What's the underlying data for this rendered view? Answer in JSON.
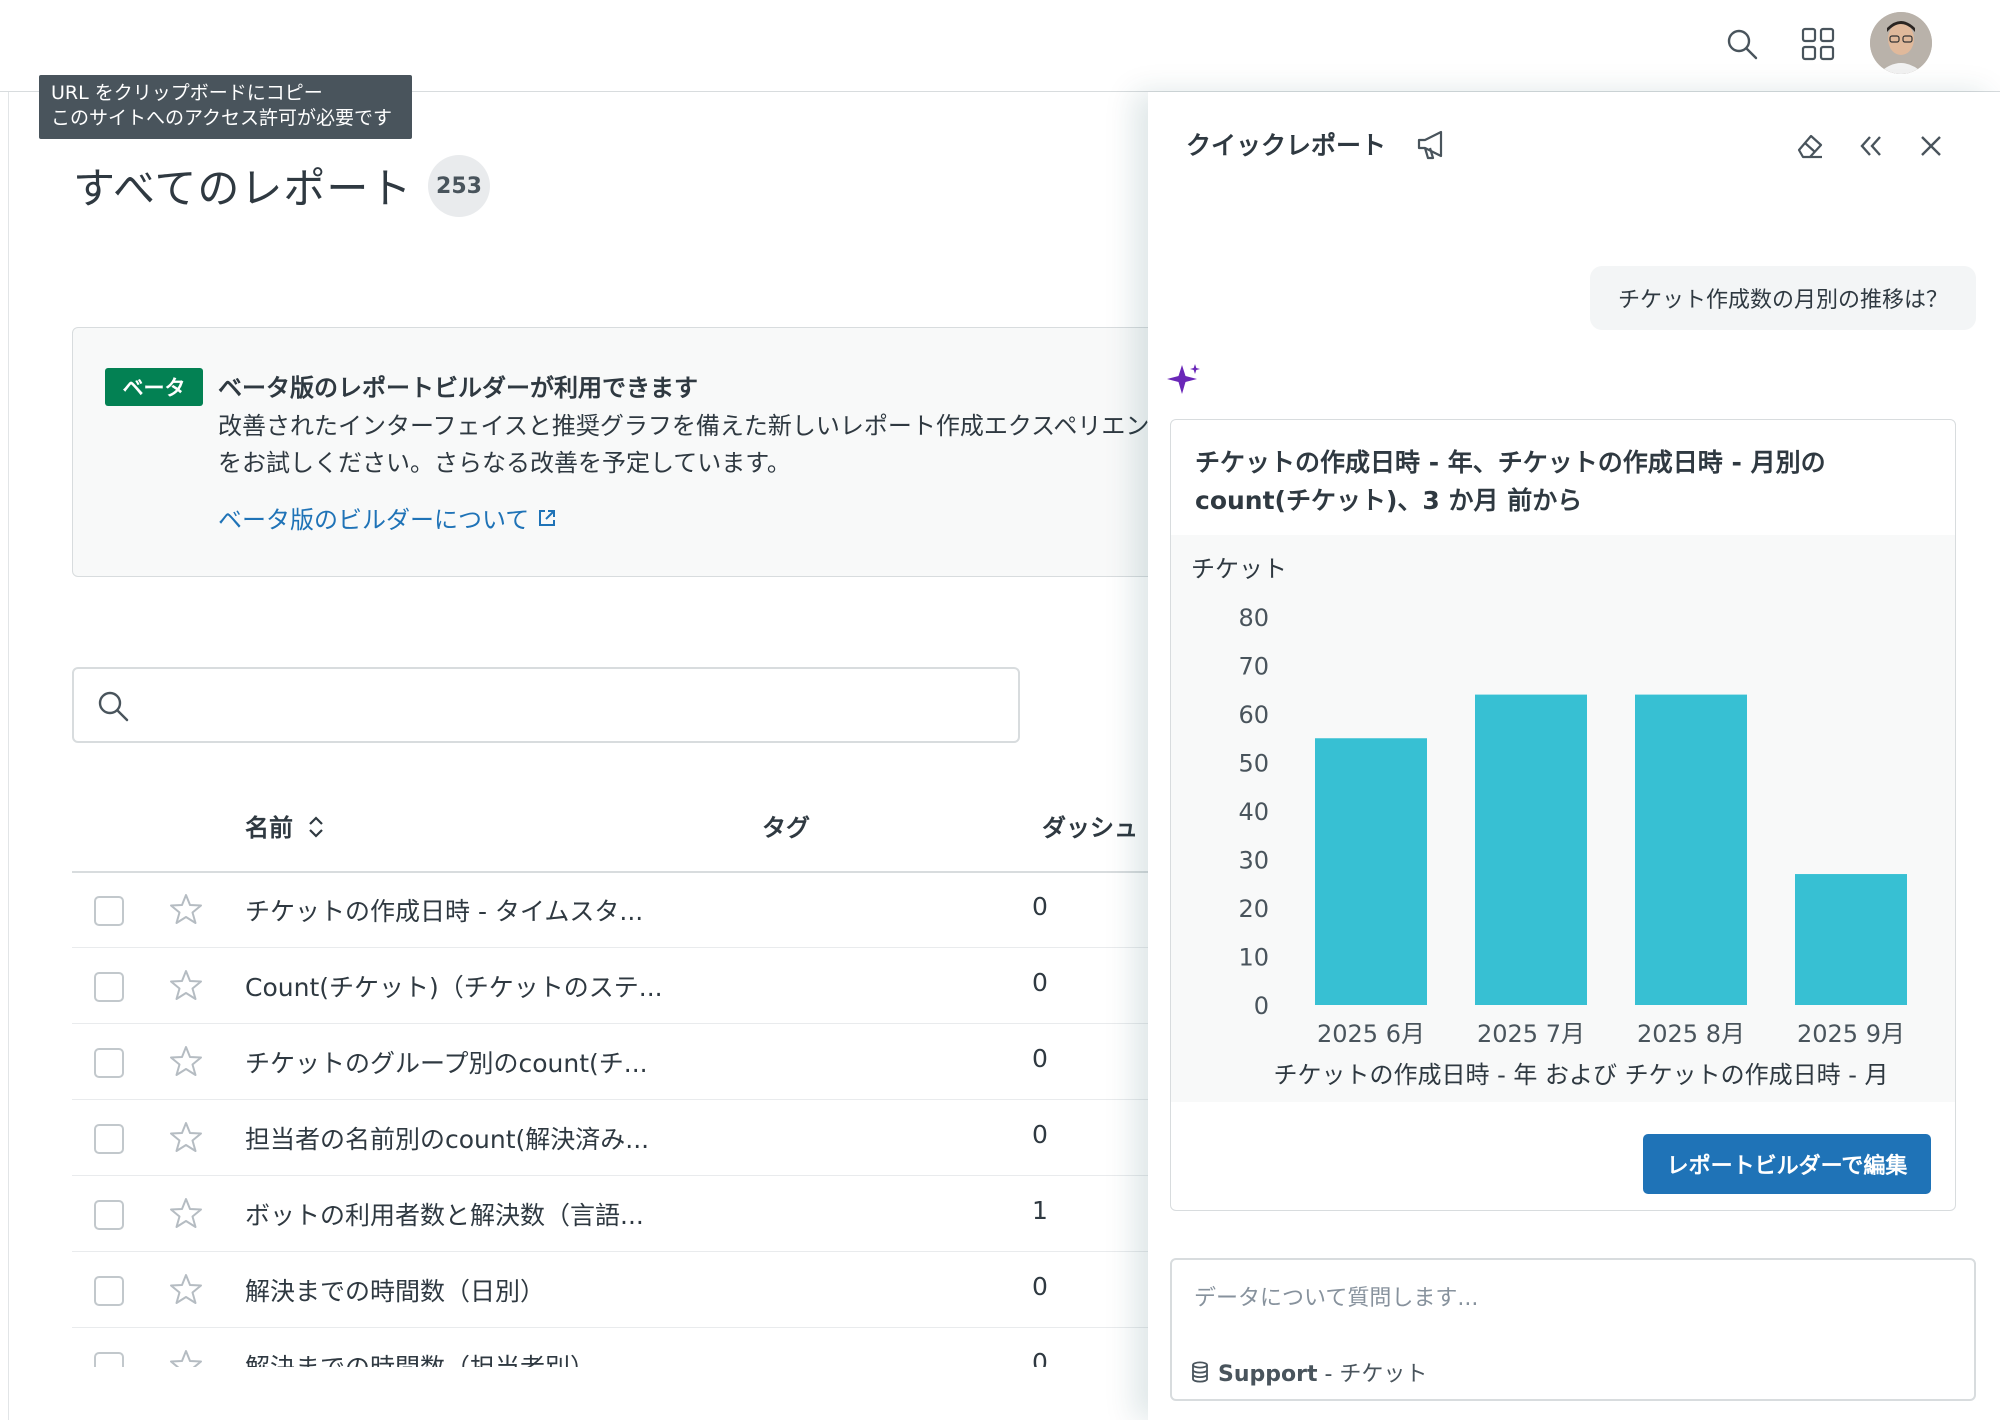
{
  "tooltip": {
    "line1": "URL をクリップボードにコピー",
    "line2": "このサイトへのアクセス許可が必要です"
  },
  "page": {
    "title": "すべてのレポート",
    "count": "253"
  },
  "beta": {
    "badge": "ベータ",
    "title": "ベータ版のレポートビルダーが利用できます",
    "body": "改善されたインターフェイスと推奨グラフを備えた新しいレポート作成エクスペリエンスをお試しください。さらなる改善を予定しています。",
    "link": "ベータ版のビルダーについて"
  },
  "search": {
    "value": "",
    "placeholder": ""
  },
  "table": {
    "headers": {
      "name": "名前",
      "tags": "タグ",
      "dashboard": "ダッシュ"
    },
    "rows": [
      {
        "name": "チケットの作成日時 - タイムスタ...",
        "dashboard": "0"
      },
      {
        "name": "Count(チケット)（チケットのステ...",
        "dashboard": "0"
      },
      {
        "name": "チケットのグループ別のcount(チ...",
        "dashboard": "0"
      },
      {
        "name": "担当者の名前別のcount(解決済み...",
        "dashboard": "0"
      },
      {
        "name": "ボットの利用者数と解決数（言語...",
        "dashboard": "1"
      },
      {
        "name": "解決までの時間数（日別）",
        "dashboard": "0"
      },
      {
        "name": "解決までの時間数（担当者別）",
        "dashboard": "0"
      }
    ]
  },
  "panel": {
    "title": "クイックレポート",
    "user_question": "チケット作成数の月別の推移は？",
    "card_title": "チケットの作成日時 - 年、チケットの作成日時 - 月別の count(チケット)、3 か月 前から",
    "edit_button": "レポートビルダーで編集",
    "ask_placeholder": "データについて質問します...",
    "source_bold": "Support",
    "source_rest": " - チケット"
  },
  "colors": {
    "bar": "#37c0d3",
    "primary": "#1f73b7",
    "beta": "#038153",
    "sparkle": "#6a27b8"
  },
  "chart_data": {
    "type": "bar",
    "categories": [
      "2025 6月",
      "2025 7月",
      "2025 8月",
      "2025 9月"
    ],
    "values": [
      55,
      64,
      64,
      27
    ],
    "ylabel": "チケット",
    "xlabel": "チケットの作成日時 - 年 および チケットの作成日時 - 月",
    "yticks": [
      0,
      10,
      20,
      30,
      40,
      50,
      60,
      70,
      80
    ],
    "ylim": [
      0,
      80
    ],
    "grid": false
  }
}
